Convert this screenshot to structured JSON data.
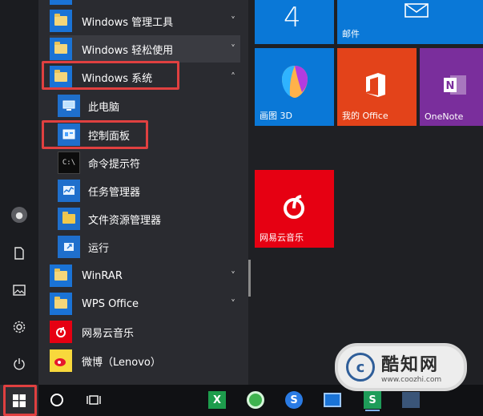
{
  "colors": {
    "tile_blue": "#0a78d7",
    "tile_red_office": "#e3431a",
    "tile_purple": "#7a2e9c",
    "tile_netease": "#e60012",
    "highlight": "#e04040"
  },
  "applist": {
    "folders": [
      {
        "label": "Windows 管理工具",
        "chevron": "˅"
      },
      {
        "label": "Windows 轻松使用",
        "chevron": "˅"
      },
      {
        "label": "Windows 系统",
        "chevron": "˄"
      }
    ],
    "system_items": [
      {
        "label": "此电脑",
        "icon": "computer-icon"
      },
      {
        "label": "控制面板",
        "icon": "control-panel-icon"
      },
      {
        "label": "命令提示符",
        "icon": "cmd-icon"
      },
      {
        "label": "任务管理器",
        "icon": "task-manager-icon"
      },
      {
        "label": "文件资源管理器",
        "icon": "file-explorer-icon"
      },
      {
        "label": "运行",
        "icon": "run-icon"
      }
    ],
    "more": [
      {
        "label": "WinRAR",
        "chevron": "˅"
      },
      {
        "label": "WPS Office",
        "chevron": "˅"
      },
      {
        "label": "网易云音乐"
      },
      {
        "label": "微博（Lenovo）"
      }
    ]
  },
  "tiles": {
    "calendar_number": "4",
    "mail": "邮件",
    "paint3d": "画图 3D",
    "myoffice": "我的 Office",
    "onenote": "OneNote",
    "netease": "网易云音乐"
  },
  "watermark": {
    "title": "酷知网",
    "url": "www.coozhi.com"
  }
}
